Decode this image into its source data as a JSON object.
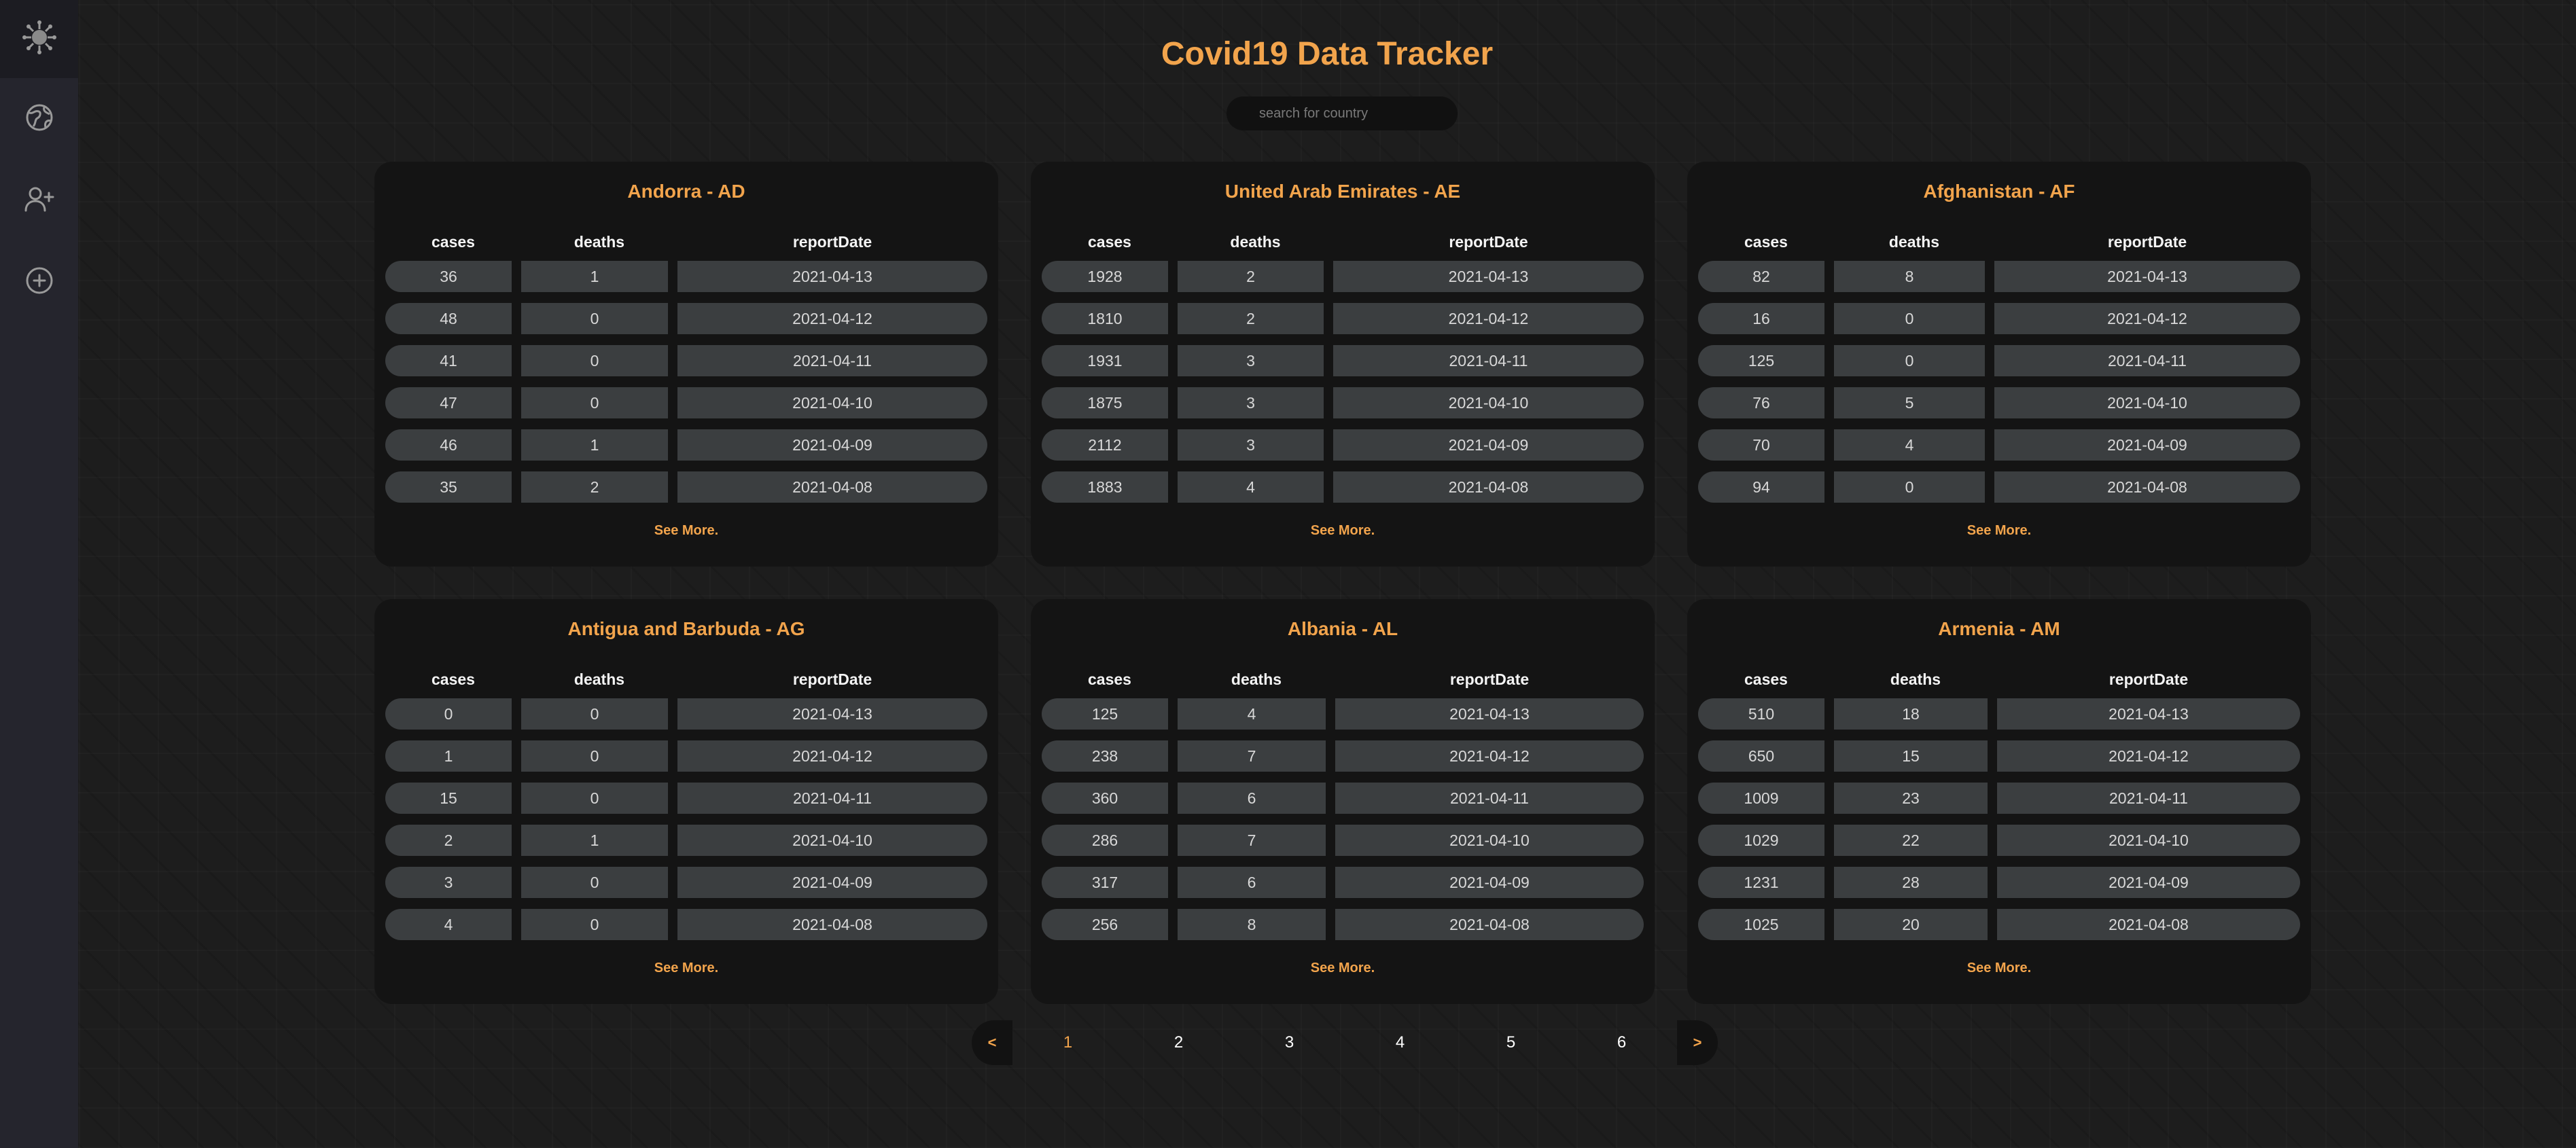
{
  "app": {
    "title": "Covid19 Data Tracker",
    "accent_color": "#f2a44c"
  },
  "sidebar": {
    "items": [
      {
        "icon": "virus-logo-icon"
      },
      {
        "icon": "globe-icon"
      },
      {
        "icon": "add-user-icon"
      },
      {
        "icon": "add-circle-icon"
      }
    ]
  },
  "search": {
    "placeholder": "search for country",
    "value": ""
  },
  "table_headers": {
    "cases": "cases",
    "deaths": "deaths",
    "date": "reportDate"
  },
  "see_more_label": "See More.",
  "cards": [
    {
      "title": "Andorra - AD",
      "rows": [
        {
          "cases": "36",
          "deaths": "1",
          "date": "2021-04-13"
        },
        {
          "cases": "48",
          "deaths": "0",
          "date": "2021-04-12"
        },
        {
          "cases": "41",
          "deaths": "0",
          "date": "2021-04-11"
        },
        {
          "cases": "47",
          "deaths": "0",
          "date": "2021-04-10"
        },
        {
          "cases": "46",
          "deaths": "1",
          "date": "2021-04-09"
        },
        {
          "cases": "35",
          "deaths": "2",
          "date": "2021-04-08"
        }
      ]
    },
    {
      "title": "United Arab Emirates - AE",
      "rows": [
        {
          "cases": "1928",
          "deaths": "2",
          "date": "2021-04-13"
        },
        {
          "cases": "1810",
          "deaths": "2",
          "date": "2021-04-12"
        },
        {
          "cases": "1931",
          "deaths": "3",
          "date": "2021-04-11"
        },
        {
          "cases": "1875",
          "deaths": "3",
          "date": "2021-04-10"
        },
        {
          "cases": "2112",
          "deaths": "3",
          "date": "2021-04-09"
        },
        {
          "cases": "1883",
          "deaths": "4",
          "date": "2021-04-08"
        }
      ]
    },
    {
      "title": "Afghanistan - AF",
      "rows": [
        {
          "cases": "82",
          "deaths": "8",
          "date": "2021-04-13"
        },
        {
          "cases": "16",
          "deaths": "0",
          "date": "2021-04-12"
        },
        {
          "cases": "125",
          "deaths": "0",
          "date": "2021-04-11"
        },
        {
          "cases": "76",
          "deaths": "5",
          "date": "2021-04-10"
        },
        {
          "cases": "70",
          "deaths": "4",
          "date": "2021-04-09"
        },
        {
          "cases": "94",
          "deaths": "0",
          "date": "2021-04-08"
        }
      ]
    },
    {
      "title": "Antigua and Barbuda - AG",
      "rows": [
        {
          "cases": "0",
          "deaths": "0",
          "date": "2021-04-13"
        },
        {
          "cases": "1",
          "deaths": "0",
          "date": "2021-04-12"
        },
        {
          "cases": "15",
          "deaths": "0",
          "date": "2021-04-11"
        },
        {
          "cases": "2",
          "deaths": "1",
          "date": "2021-04-10"
        },
        {
          "cases": "3",
          "deaths": "0",
          "date": "2021-04-09"
        },
        {
          "cases": "4",
          "deaths": "0",
          "date": "2021-04-08"
        }
      ]
    },
    {
      "title": "Albania - AL",
      "rows": [
        {
          "cases": "125",
          "deaths": "4",
          "date": "2021-04-13"
        },
        {
          "cases": "238",
          "deaths": "7",
          "date": "2021-04-12"
        },
        {
          "cases": "360",
          "deaths": "6",
          "date": "2021-04-11"
        },
        {
          "cases": "286",
          "deaths": "7",
          "date": "2021-04-10"
        },
        {
          "cases": "317",
          "deaths": "6",
          "date": "2021-04-09"
        },
        {
          "cases": "256",
          "deaths": "8",
          "date": "2021-04-08"
        }
      ]
    },
    {
      "title": "Armenia - AM",
      "rows": [
        {
          "cases": "510",
          "deaths": "18",
          "date": "2021-04-13"
        },
        {
          "cases": "650",
          "deaths": "15",
          "date": "2021-04-12"
        },
        {
          "cases": "1009",
          "deaths": "23",
          "date": "2021-04-11"
        },
        {
          "cases": "1029",
          "deaths": "22",
          "date": "2021-04-10"
        },
        {
          "cases": "1231",
          "deaths": "28",
          "date": "2021-04-09"
        },
        {
          "cases": "1025",
          "deaths": "20",
          "date": "2021-04-08"
        }
      ]
    }
  ],
  "pagination": {
    "prev_label": "<",
    "next_label": ">",
    "pages": [
      "1",
      "2",
      "3",
      "4",
      "5",
      "6"
    ],
    "current_page": "1"
  }
}
